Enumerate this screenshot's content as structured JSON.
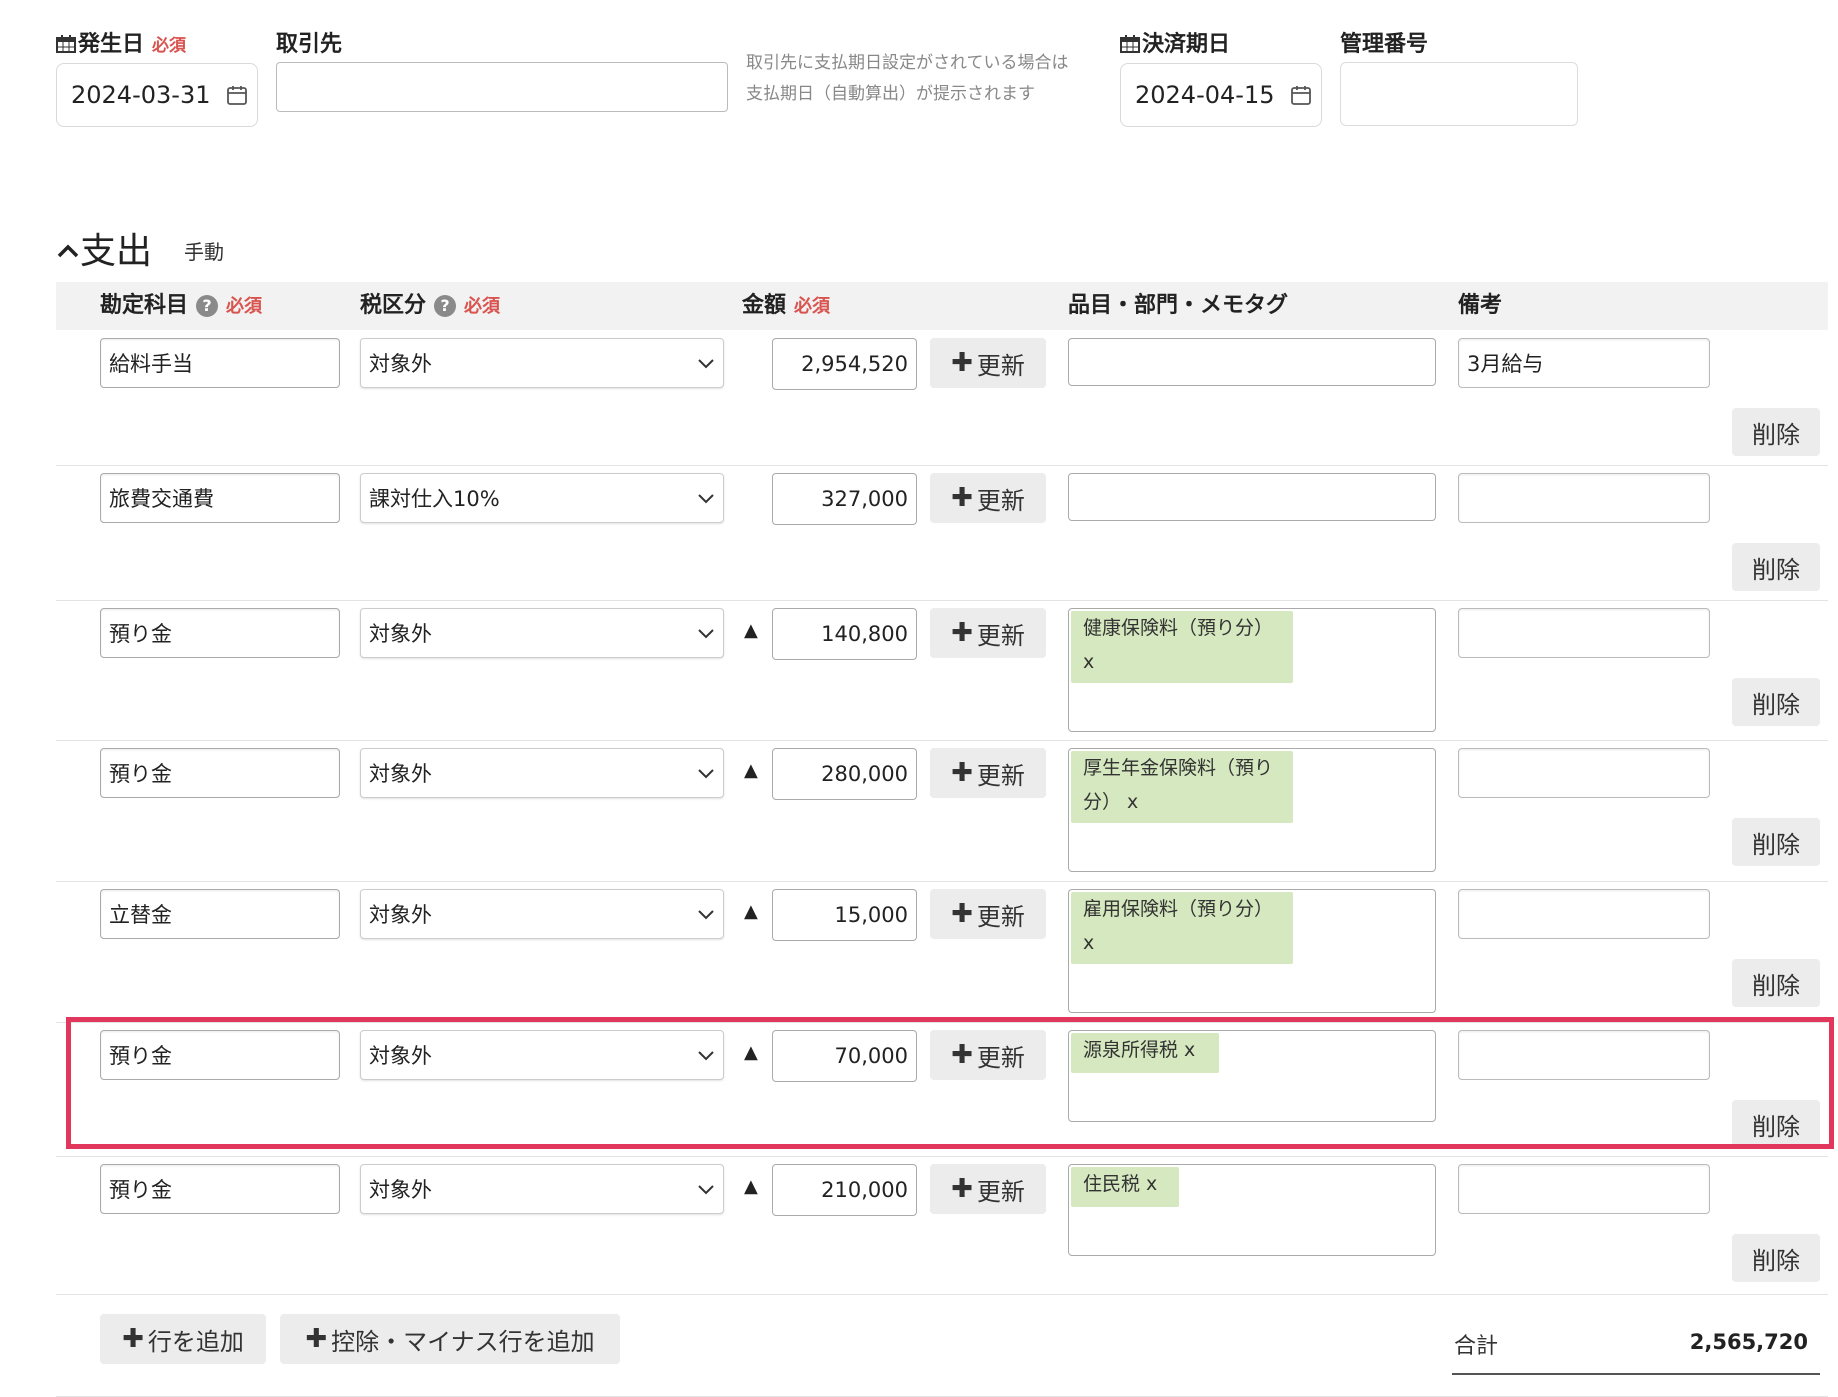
{
  "header": {
    "issue_date": {
      "label": "発生日",
      "required": "必須",
      "value": "2024-03-31"
    },
    "partner": {
      "label": "取引先",
      "value": ""
    },
    "partner_hint_line1": "取引先に支払期日設定がされている場合は",
    "partner_hint_line2": "支払期日（自動算出）が提示されます",
    "settlement_date": {
      "label": "決済期日",
      "value": "2024-04-15"
    },
    "management_no": {
      "label": "管理番号",
      "value": ""
    }
  },
  "section": {
    "title": "支出",
    "mode": "手動"
  },
  "columns": {
    "account": "勘定科目",
    "tax": "税区分",
    "amount": "金額",
    "tags": "品目・部門・メモタグ",
    "note": "備考",
    "required": "必須",
    "help": "?"
  },
  "update_label": "更新",
  "delete_label": "削除",
  "minus_mark": "▲",
  "rows": [
    {
      "account": "給料手当",
      "tax": "対象外",
      "amount": "2,954,520",
      "tag": "",
      "note": "3月給与"
    },
    {
      "account": "旅費交通費",
      "tax": "課対仕入10%",
      "amount": "327,000",
      "tag": "",
      "note": ""
    },
    {
      "account": "預り金",
      "tax": "対象外",
      "amount": "140,800",
      "tag": "健康保険料（預り分） x",
      "note": ""
    },
    {
      "account": "預り金",
      "tax": "対象外",
      "amount": "280,000",
      "tag": "厚生年金保険料（預り分） x",
      "note": ""
    },
    {
      "account": "立替金",
      "tax": "対象外",
      "amount": "15,000",
      "tag": "雇用保険料（預り分） x",
      "note": ""
    },
    {
      "account": "預り金",
      "tax": "対象外",
      "amount": "70,000",
      "tag": "源泉所得税 x",
      "note": ""
    },
    {
      "account": "預り金",
      "tax": "対象外",
      "amount": "210,000",
      "tag": "住民税 x",
      "note": ""
    }
  ],
  "footer": {
    "add_row": "行を追加",
    "add_deduction_row": "控除・マイナス行を追加",
    "total_label": "合計",
    "total_value": "2,565,720"
  },
  "colors": {
    "required": "#d9534f",
    "tag_bg": "#d6e8bf",
    "highlight": "#e1375c",
    "button_bg": "#ececec"
  }
}
